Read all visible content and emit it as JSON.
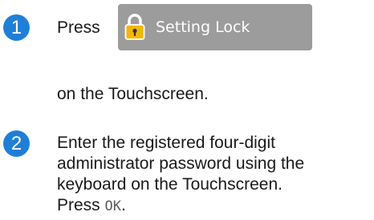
{
  "steps": [
    {
      "number": "1",
      "press": "Press",
      "button_label": "Setting Lock",
      "after": "on the Touchscreen."
    },
    {
      "number": "2",
      "lines": [
        "Enter the registered four-digit",
        "administrator password using the",
        "keyboard on the Touchscreen."
      ],
      "press": "Press",
      "ok": "OK",
      "end": "."
    }
  ],
  "colors": {
    "step_badge": "#1f7fd6",
    "button_bg": "#9c9c9c",
    "lock_body": "#f2b705"
  },
  "icons": {
    "lock": "padlock-icon"
  }
}
